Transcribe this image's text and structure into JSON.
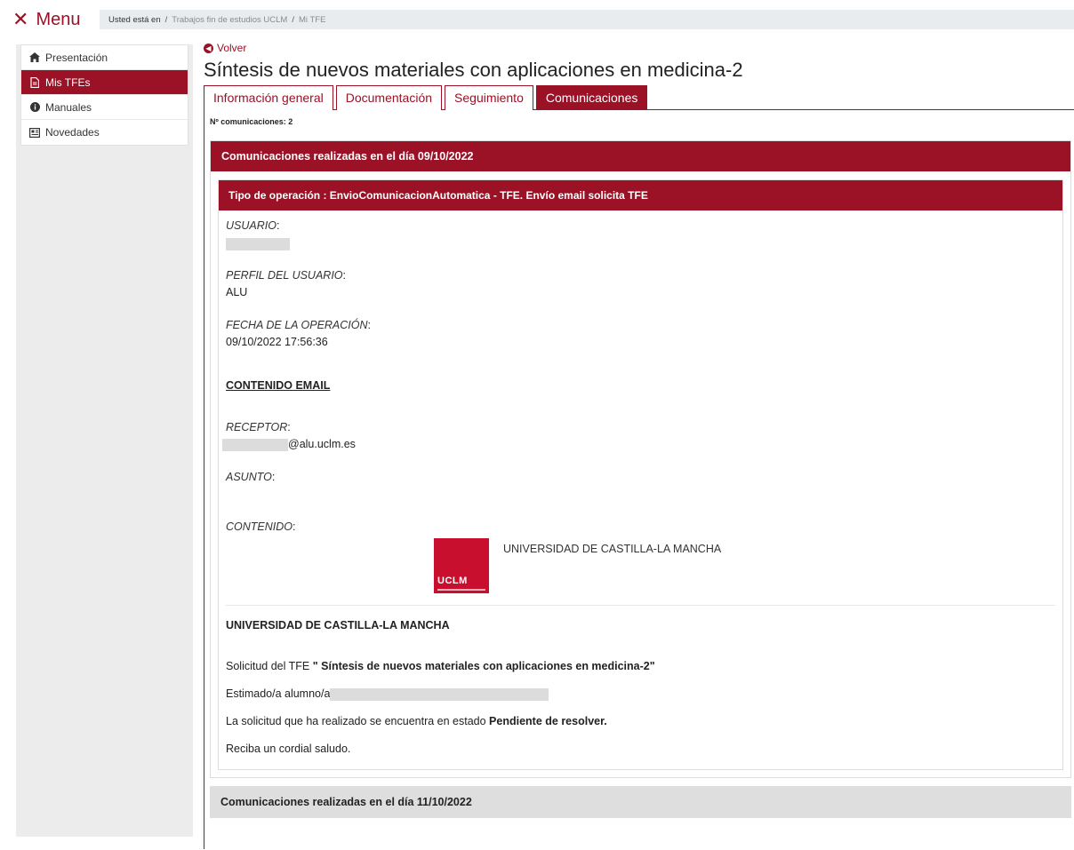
{
  "top": {
    "menu_icon": "close-icon",
    "menu_label": "Menu",
    "breadcrumb_prefix": "Usted está en",
    "breadcrumb_sep": "/",
    "breadcrumb_1": "Trabajos fin de estudios UCLM",
    "breadcrumb_2": "Mi TFE"
  },
  "sidebar": {
    "items": [
      {
        "label": "Presentación",
        "icon": "home-icon",
        "active": false
      },
      {
        "label": "Mis TFEs",
        "icon": "document-icon",
        "active": true
      },
      {
        "label": "Manuales",
        "icon": "info-icon",
        "active": false
      },
      {
        "label": "Novedades",
        "icon": "newspaper-icon",
        "active": false
      }
    ]
  },
  "main": {
    "back_label": "Volver",
    "title": "Síntesis de nuevos materiales con aplicaciones en medicina-2",
    "tabs": [
      {
        "label": "Información general",
        "active": false
      },
      {
        "label": "Documentación",
        "active": false
      },
      {
        "label": "Seguimiento",
        "active": false
      },
      {
        "label": "Comunicaciones",
        "active": true
      }
    ],
    "count_text": "Nº comunicaciones: 2",
    "panel1": {
      "title": "Comunicaciones realizadas en el día 09/10/2022",
      "operation_title": "Tipo de operación : EnvioComunicacionAutomatica - TFE. Envío email solicita TFE",
      "usuario_label": "USUARIO",
      "perfil_label": "PERFIL DEL USUARIO",
      "perfil_value": "ALU",
      "fecha_label": "FECHA DE LA OPERACIÓN",
      "fecha_value": "09/10/2022 17:56:36",
      "contenido_email_heading": "CONTENIDO EMAIL",
      "receptor_label": "RECEPTOR",
      "receptor_suffix": "@alu.uclm.es",
      "asunto_label": "ASUNTO",
      "contenido_label": "CONTENIDO",
      "logo_text": "UCLM",
      "logo_university": "UNIVERSIDAD DE CASTILLA-LA MANCHA",
      "email_heading": "UNIVERSIDAD DE CASTILLA-LA MANCHA",
      "solicitud_prefix": "Solicitud del TFE ",
      "solicitud_title": "\" Síntesis de nuevos materiales con aplicaciones en medicina-2\"",
      "estimado": "Estimado/a alumno/a",
      "estado_prefix": "La solicitud que ha realizado se encuentra en estado ",
      "estado_value": "Pendiente de resolver.",
      "saludo": "Reciba un cordial saludo."
    },
    "panel2": {
      "title": "Comunicaciones realizadas en el día 11/10/2022"
    }
  },
  "colors": {
    "brand": "#9b1126",
    "logo": "#c8102e"
  }
}
